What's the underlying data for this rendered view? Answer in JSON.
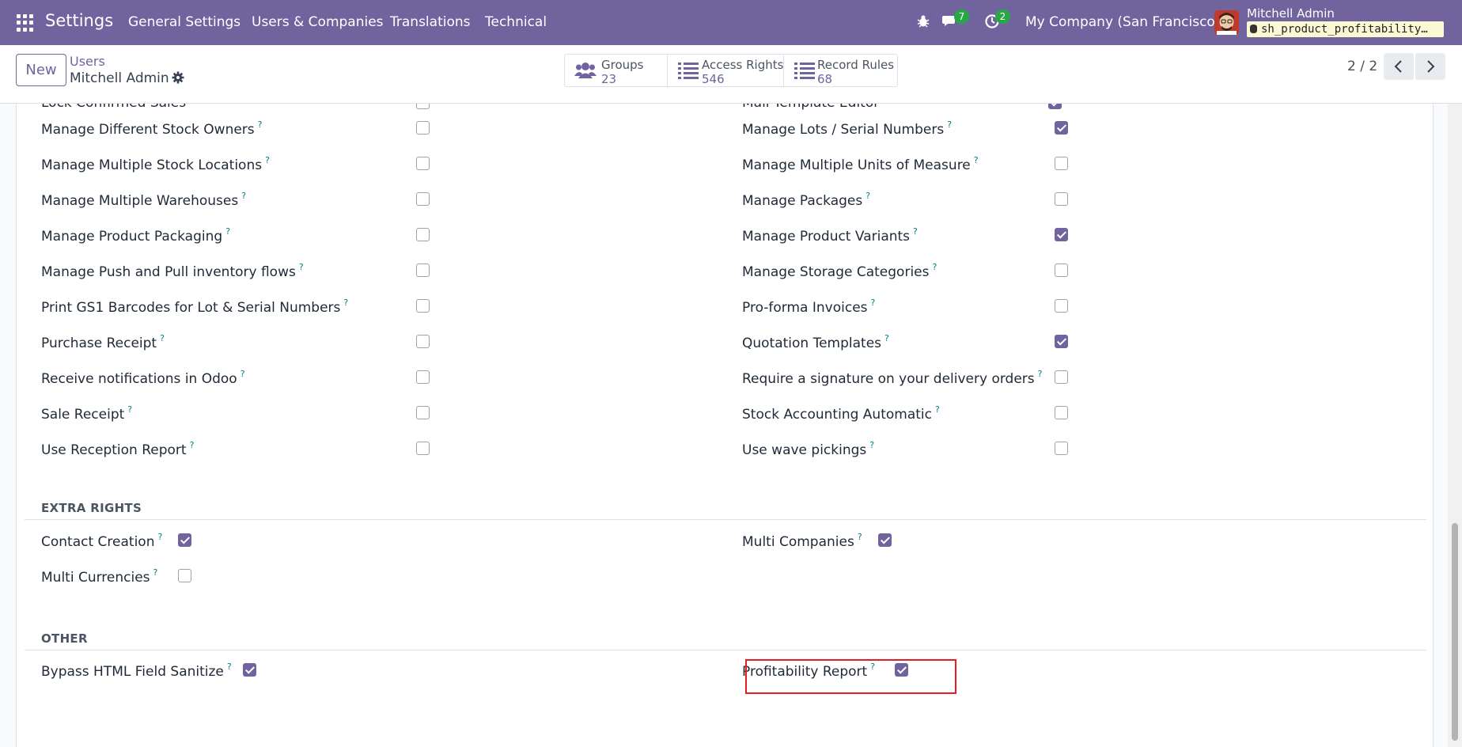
{
  "navbar": {
    "app_title": "Settings",
    "menus": [
      "General Settings",
      "Users & Companies",
      "Translations",
      "Technical"
    ],
    "messages_count": "7",
    "activities_count": "2",
    "company": "My Company (San Francisco)",
    "user_name": "Mitchell Admin",
    "database": "sh_product_profitability…"
  },
  "control": {
    "new_label": "New",
    "breadcrumb_parent": "Users",
    "breadcrumb_current": "Mitchell Admin",
    "stats": [
      {
        "label": "Groups",
        "value": "23",
        "icon": "users-icon"
      },
      {
        "label": "Access Rights",
        "value": "546",
        "icon": "list-icon"
      },
      {
        "label": "Record Rules",
        "value": "68",
        "icon": "list-icon"
      }
    ],
    "pager": "2 / 2"
  },
  "rights": {
    "cut_left": "Lock Confirmed Sales",
    "cut_right": "Mail Template Editor",
    "left": [
      {
        "label": "Manage Different Stock Owners",
        "checked": false
      },
      {
        "label": "Manage Multiple Stock Locations",
        "checked": false
      },
      {
        "label": "Manage Multiple Warehouses",
        "checked": false
      },
      {
        "label": "Manage Product Packaging",
        "checked": false
      },
      {
        "label": "Manage Push and Pull inventory flows",
        "checked": false
      },
      {
        "label": "Print GS1 Barcodes for Lot & Serial Numbers",
        "checked": false
      },
      {
        "label": "Purchase Receipt",
        "checked": false
      },
      {
        "label": "Receive notifications in Odoo",
        "checked": false
      },
      {
        "label": "Sale Receipt",
        "checked": false
      },
      {
        "label": "Use Reception Report",
        "checked": false
      }
    ],
    "right": [
      {
        "label": "Manage Lots / Serial Numbers",
        "checked": true
      },
      {
        "label": "Manage Multiple Units of Measure",
        "checked": false
      },
      {
        "label": "Manage Packages",
        "checked": false
      },
      {
        "label": "Manage Product Variants",
        "checked": true
      },
      {
        "label": "Manage Storage Categories",
        "checked": false
      },
      {
        "label": "Pro-forma Invoices",
        "checked": false
      },
      {
        "label": "Quotation Templates",
        "checked": true
      },
      {
        "label": "Require a signature on your delivery orders",
        "checked": false
      },
      {
        "label": "Stock Accounting Automatic",
        "checked": false
      },
      {
        "label": "Use wave pickings",
        "checked": false
      }
    ],
    "help_mark": "?"
  },
  "extra_rights": {
    "title": "EXTRA RIGHTS",
    "contact_creation": {
      "label": "Contact Creation",
      "checked": true
    },
    "multi_companies": {
      "label": "Multi Companies",
      "checked": true
    },
    "multi_currencies": {
      "label": "Multi Currencies",
      "checked": false
    }
  },
  "other": {
    "title": "OTHER",
    "bypass_html": {
      "label": "Bypass HTML Field Sanitize",
      "checked": true
    },
    "profitability_report": {
      "label": "Profitability Report",
      "checked": true
    }
  },
  "colors": {
    "brand": "#71639e",
    "help": "#017e84",
    "badge": "#28a745",
    "highlight": "#e51c23"
  }
}
